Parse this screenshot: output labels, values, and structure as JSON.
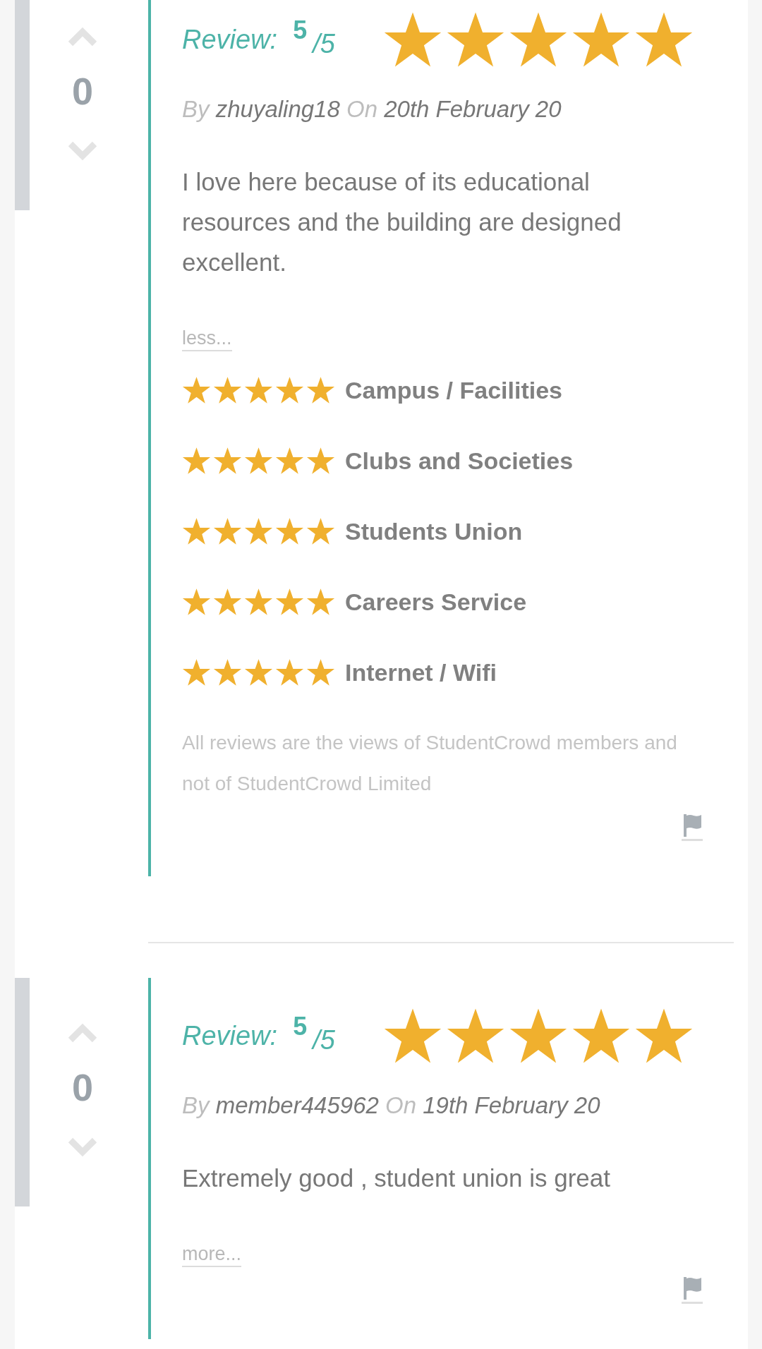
{
  "reviews": [
    {
      "votes": "0",
      "label": "Review:",
      "score": "5",
      "score_max": "/5",
      "stars": 5,
      "by_label": "By",
      "author": "zhuyaling18",
      "on_label": "On",
      "date": "20th February 20",
      "body": "I love here because of its educational resources and the building are designed excellent.",
      "toggle_link": "less...",
      "categories": [
        {
          "name": "Campus / Facilities",
          "stars": 5
        },
        {
          "name": "Clubs and Societies",
          "stars": 5
        },
        {
          "name": "Students Union",
          "stars": 5
        },
        {
          "name": "Careers Service",
          "stars": 5
        },
        {
          "name": "Internet / Wifi",
          "stars": 5
        }
      ],
      "disclaimer": "All reviews are the views of StudentCrowd members and not of StudentCrowd Limited"
    },
    {
      "votes": "0",
      "label": "Review:",
      "score": "5",
      "score_max": "/5",
      "stars": 5,
      "by_label": "By",
      "author": "member445962",
      "on_label": "On",
      "date": "19th February 20",
      "body": "Extremely good , student union is great",
      "toggle_link": "more..."
    }
  ]
}
